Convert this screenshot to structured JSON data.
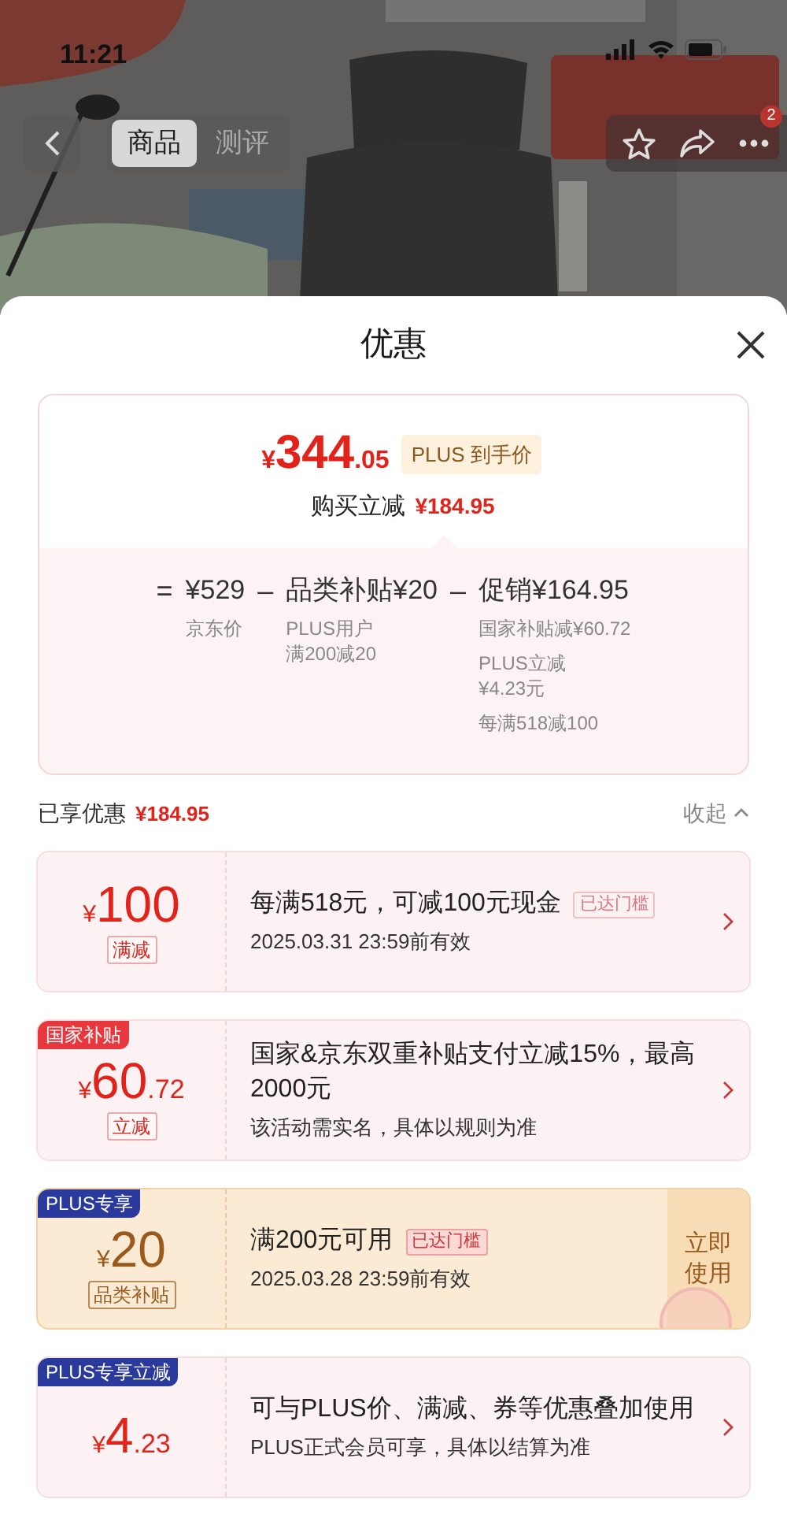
{
  "status_bar": {
    "time": "11:21"
  },
  "nav": {
    "tabs": [
      {
        "label": "商品",
        "selected": true
      },
      {
        "label": "测评",
        "selected": false
      }
    ],
    "badge": "2"
  },
  "sheet": {
    "title": "优惠"
  },
  "price": {
    "currency": "¥",
    "integer": "344",
    "decimal": ".05",
    "tag": "PLUS 到手价",
    "saving_label": "购买立减",
    "saving": "¥184.95",
    "breakdown": [
      {
        "operator": "=",
        "text": "¥529",
        "notes": [
          {
            "text": "京东价",
            "narrow": false
          }
        ]
      },
      {
        "operator": "–",
        "text": "品类补贴¥20",
        "notes": [
          {
            "text": "PLUS用户满200减20",
            "narrow": true
          }
        ]
      },
      {
        "operator": "–",
        "text": "促销¥164.95",
        "notes": [
          {
            "text": "国家补贴减¥60.72",
            "narrow": false
          },
          {
            "text": "PLUS立减¥4.23元",
            "narrow": true
          },
          {
            "text": "每满518减100",
            "narrow": false
          }
        ]
      }
    ]
  },
  "summary": {
    "label": "已享优惠",
    "amount": "¥184.95",
    "toggle": "收起",
    "expanded": true
  },
  "coupons": [
    {
      "kind": "discount",
      "currency": "¥",
      "amount": "100",
      "label": "满减",
      "title": "每满518元，可减100元现金",
      "reached": "已达门槛",
      "subtitle": "2025.03.31 23:59前有效"
    },
    {
      "kind": "discount",
      "tag": "国家补贴",
      "color": "#e8383d",
      "currency": "¥",
      "amount": "60",
      "decimal": ".72",
      "label": "立减",
      "title": "国家&京东双重补贴支付立减15%，最高2000元",
      "subtitle": "该活动需实名，具体以规则为准"
    },
    {
      "kind": "plus",
      "tag": "PLUS专享",
      "color": "#2a3a9c",
      "currency": "¥",
      "amount": "20",
      "label": "品类补贴",
      "title": "满200元可用",
      "reached": "已达门槛",
      "subtitle": "2025.03.28 23:59前有效",
      "action": "立即使用"
    },
    {
      "kind": "discount",
      "tag": "PLUS专享立减",
      "color": "#2a3a9c",
      "currency": "¥",
      "amount": "4",
      "decimal": ".23",
      "title": "可与PLUS价、满减、券等优惠叠加使用",
      "subtitle": "PLUS正式会员可享，具体以结算为准"
    }
  ]
}
